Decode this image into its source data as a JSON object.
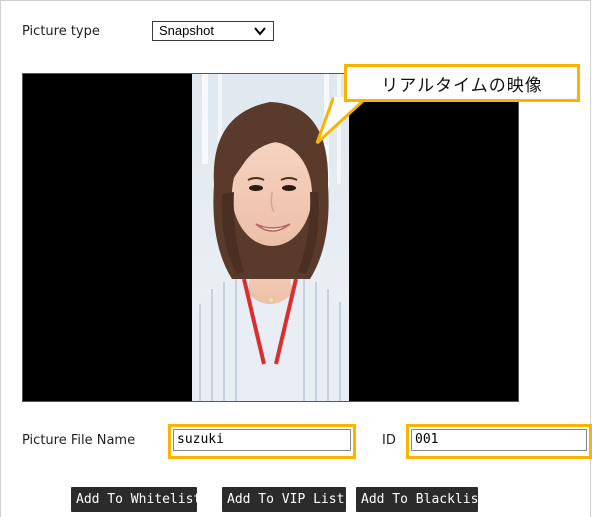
{
  "form": {
    "picture_type_label": "Picture type",
    "picture_type_value": "Snapshot",
    "picture_file_name_label": "Picture File Name",
    "picture_file_name_value": "suzuki",
    "id_label": "ID",
    "id_value": "001"
  },
  "callout": {
    "text": "リアルタイムの映像"
  },
  "buttons": {
    "whitelist": "Add To Whitelist",
    "vip": "Add To VIP List",
    "blacklist": "Add To Blacklist"
  },
  "colors": {
    "highlight": "#f7b500",
    "video_bg": "#000000",
    "button_bg": "#2b2b2b"
  },
  "icons": {
    "select_chevron": "chevron-down-icon"
  }
}
